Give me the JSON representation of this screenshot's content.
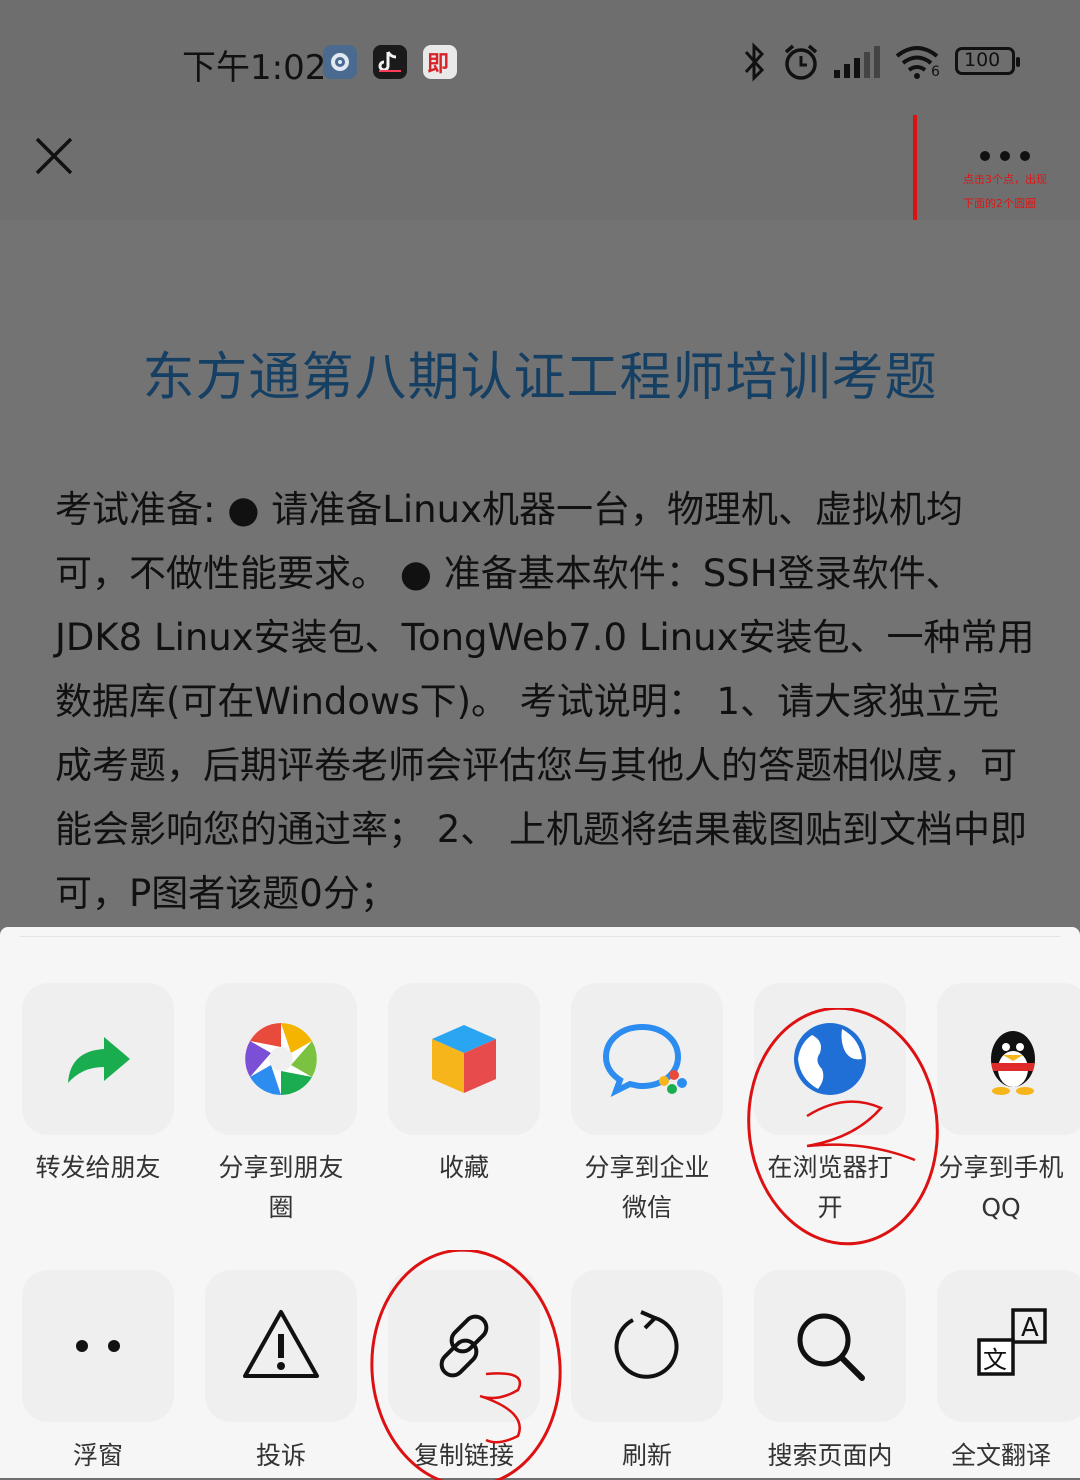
{
  "status_bar": {
    "time": "下午1:02",
    "app_icon_red_label": "即",
    "battery": "100",
    "wifi_label": "6"
  },
  "nav": {
    "close_icon": "close-icon",
    "more_icon": "more-icon"
  },
  "annotation": {
    "note_line1": "点击3个点，出现",
    "note_line2": "下面的2个圆圈",
    "mark_2": "2",
    "mark_3": "3"
  },
  "article": {
    "title": "东方通第八期认证工程师培训考题",
    "body": "考试准备: ● 请准备Linux机器一台，物理机、虚拟机均可，不做性能要求。 ● 准备基本软件：SSH登录软件、JDK8 Linux安装包、TongWeb7.0 Linux安装包、一种常用数据库(可在Windows下)。 考试说明： 1、请大家独立完成考题，后期评卷老师会评估您与其他人的答题相似度，可能会影响您的通过率； 2、 上机题将结果截图贴到文档中即可，P图者该题0分；"
  },
  "share_sheet": {
    "row1": [
      {
        "label": "转发给朋友",
        "icon": "forward-icon"
      },
      {
        "label": "分享到朋友\n圈",
        "icon": "moments-icon"
      },
      {
        "label": "收藏",
        "icon": "favorite-icon"
      },
      {
        "label": "分享到企业\n微信",
        "icon": "wecom-icon"
      },
      {
        "label": "在浏览器打\n开",
        "icon": "browser-icon"
      },
      {
        "label": "分享到手机\nQQ",
        "icon": "qq-icon"
      }
    ],
    "row2": [
      {
        "label": "浮窗",
        "icon": "float-window-icon"
      },
      {
        "label": "投诉",
        "icon": "warning-icon"
      },
      {
        "label": "复制链接",
        "icon": "link-icon"
      },
      {
        "label": "刷新",
        "icon": "refresh-icon"
      },
      {
        "label": "搜索页面内",
        "icon": "search-icon"
      },
      {
        "label": "全文翻译",
        "icon": "translate-icon"
      }
    ]
  },
  "colors": {
    "title_blue": "#153f63",
    "annotation_red": "#e01515",
    "overlay_gray": "#707070",
    "sheet_bg": "#f6f6f6"
  }
}
